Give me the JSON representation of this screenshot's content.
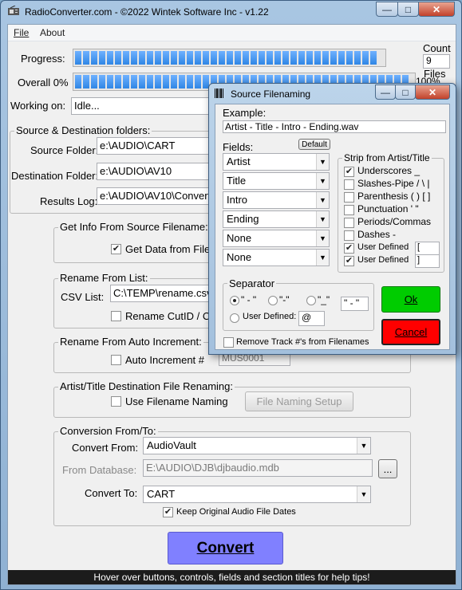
{
  "window": {
    "title": "RadioConverter.com - ©2022 Wintek Software Inc - v1.22",
    "minimize": "—",
    "maximize": "□",
    "close": "✕"
  },
  "menu": {
    "file": "File",
    "about": "About"
  },
  "progress": {
    "progress_label": "Progress:",
    "overall_label": "Overall 0%",
    "overall_pct_right": "100%",
    "count_label": "Count",
    "count_value": "9",
    "files_label": "Files",
    "progress_fraction": 1.0,
    "overall_fraction": 1.0
  },
  "working": {
    "label": "Working on:",
    "value": "Idle..."
  },
  "folders": {
    "title": "Source & Destination folders:",
    "source_label": "Source Folder:",
    "source_value": "e:\\AUDIO\\CART",
    "dest_label": "Destination Folder:",
    "dest_value": "e:\\AUDIO\\AV10",
    "log_label": "Results Log:",
    "log_value": "e:\\AUDIO\\AV10\\Convert"
  },
  "get_info": {
    "title": "Get Info From Source Filename:",
    "checkbox_label": "Get Data from File"
  },
  "rename_list": {
    "title": "Rename From List:",
    "csv_label": "CSV List:",
    "csv_value": "C:\\TEMP\\rename.csv",
    "checkbox_label": "Rename CutID / C"
  },
  "auto_increment": {
    "title": "Rename From Auto Increment:",
    "checkbox_label": "Auto Increment #",
    "value": "MUS0001"
  },
  "artist_title": {
    "title": "Artist/Title Destination File Renaming:",
    "checkbox_label": "Use Filename Naming",
    "setup_button": "File Naming Setup"
  },
  "conversion": {
    "title": "Conversion From/To:",
    "from_label": "Convert From:",
    "from_value": "AudioVault",
    "db_label": "From Database:",
    "db_value": "E:\\AUDIO\\DJB\\djbaudio.mdb",
    "browse": "...",
    "to_label": "Convert To:",
    "to_value": "CART",
    "keep_dates": "Keep Original Audio File Dates"
  },
  "convert_button": "Convert",
  "status": "Hover over buttons, controls, fields and section titles for help tips!",
  "dialog": {
    "title": "Source Filenaming",
    "example_label": "Example:",
    "example_value": "Artist - Title - Intro - Ending.wav",
    "fields_label": "Fields:",
    "default_button": "Default",
    "fields": [
      "Artist",
      "Title",
      "Intro",
      "Ending",
      "None",
      "None"
    ],
    "strip": {
      "title": "Strip from Artist/Title",
      "items": [
        {
          "label": "Underscores _",
          "checked": true
        },
        {
          "label": "Slashes-Pipe / \\ |",
          "checked": false
        },
        {
          "label": "Parenthesis ( ) [ ]",
          "checked": false
        },
        {
          "label": "Punctuation ' \"",
          "checked": false
        },
        {
          "label": "Periods/Commas",
          "checked": false
        },
        {
          "label": "Dashes -",
          "checked": false
        },
        {
          "label": "User Defined",
          "checked": true,
          "value": "["
        },
        {
          "label": "User Defined",
          "checked": true,
          "value": "]"
        }
      ]
    },
    "separator": {
      "title": "Separator",
      "opt1": "\" - \"",
      "opt2": "\"-\"",
      "opt3": "\"_\"",
      "preview": "\" - \"",
      "user_label": "User Defined:",
      "user_value": "@"
    },
    "ok": "Ok",
    "cancel": "Cancel",
    "remove_track": "Remove Track #'s from Filenames"
  }
}
